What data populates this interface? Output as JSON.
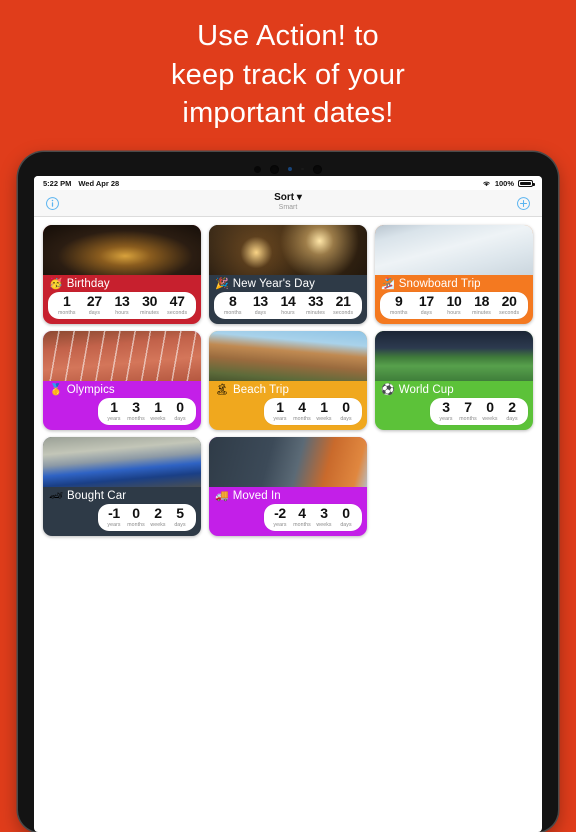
{
  "promo": {
    "lines": [
      "Use Action! to",
      "keep track of your",
      "important dates!"
    ],
    "bg_color": "#E03D1B",
    "text_color": "#FFFFFF"
  },
  "status_bar": {
    "time": "5:22 PM",
    "date": "Wed Apr 28",
    "wifi_icon": "wifi-icon",
    "battery_percent": "100%",
    "battery_icon": "battery-full-icon"
  },
  "navbar": {
    "info_icon": "info-circle-icon",
    "sort_label": "Sort ▾",
    "sort_sublabel": "Smart",
    "add_icon": "plus-circle-icon"
  },
  "cards": [
    {
      "title": "Birthday",
      "emoji": "🥳",
      "icon_name": "party-face-emoji",
      "color": "#C7202E",
      "photo": "birthday-cake-candles-photo",
      "pill_mode": "full",
      "units": [
        {
          "value": "1",
          "label": "months"
        },
        {
          "value": "27",
          "label": "days"
        },
        {
          "value": "13",
          "label": "hours"
        },
        {
          "value": "30",
          "label": "minutes"
        },
        {
          "value": "47",
          "label": "seconds"
        }
      ]
    },
    {
      "title": "New Year's Day",
      "emoji": "🎉",
      "icon_name": "party-popper-emoji",
      "color": "#2E3A47",
      "photo": "sparkler-bokeh-photo",
      "pill_mode": "full",
      "units": [
        {
          "value": "8",
          "label": "months"
        },
        {
          "value": "13",
          "label": "days"
        },
        {
          "value": "14",
          "label": "hours"
        },
        {
          "value": "33",
          "label": "minutes"
        },
        {
          "value": "21",
          "label": "seconds"
        }
      ]
    },
    {
      "title": "Snowboard Trip",
      "emoji": "🏂",
      "icon_name": "snowboarder-emoji",
      "color": "#F47920",
      "photo": "snowy-mountain-slope-photo",
      "pill_mode": "full",
      "units": [
        {
          "value": "9",
          "label": "months"
        },
        {
          "value": "17",
          "label": "days"
        },
        {
          "value": "10",
          "label": "hours"
        },
        {
          "value": "18",
          "label": "minutes"
        },
        {
          "value": "20",
          "label": "seconds"
        }
      ]
    },
    {
      "title": "Olympics",
      "emoji": "🥇",
      "icon_name": "gold-medal-emoji",
      "color": "#C31FE8",
      "photo": "running-track-athletes-photo",
      "pill_mode": "four",
      "units": [
        {
          "value": "1",
          "label": "years"
        },
        {
          "value": "3",
          "label": "months"
        },
        {
          "value": "1",
          "label": "weeks"
        },
        {
          "value": "0",
          "label": "days"
        }
      ]
    },
    {
      "title": "Beach Trip",
      "emoji": "🏝",
      "icon_name": "desert-island-emoji",
      "color": "#F0A81E",
      "photo": "cinque-terre-cliffside-town-photo",
      "pill_mode": "four",
      "units": [
        {
          "value": "1",
          "label": "years"
        },
        {
          "value": "4",
          "label": "months"
        },
        {
          "value": "1",
          "label": "weeks"
        },
        {
          "value": "0",
          "label": "days"
        }
      ]
    },
    {
      "title": "World Cup",
      "emoji": "⚽",
      "icon_name": "soccer-ball-emoji",
      "color": "#5CC239",
      "photo": "soccer-stadium-pitch-photo",
      "pill_mode": "four",
      "units": [
        {
          "value": "3",
          "label": "years"
        },
        {
          "value": "7",
          "label": "months"
        },
        {
          "value": "0",
          "label": "weeks"
        },
        {
          "value": "2",
          "label": "days"
        }
      ]
    },
    {
      "title": "Bought Car",
      "emoji": "🏎",
      "icon_name": "racing-car-emoji",
      "color": "#2E3A47",
      "photo": "blue-sports-car-photo",
      "pill_mode": "four",
      "units": [
        {
          "value": "-1",
          "label": "years"
        },
        {
          "value": "0",
          "label": "months"
        },
        {
          "value": "2",
          "label": "weeks"
        },
        {
          "value": "5",
          "label": "days"
        }
      ]
    },
    {
      "title": "Moved In",
      "emoji": "🚚",
      "icon_name": "delivery-truck-emoji",
      "color": "#C31FE8",
      "photo": "apartment-building-balconies-photo",
      "pill_mode": "four",
      "units": [
        {
          "value": "-2",
          "label": "years"
        },
        {
          "value": "4",
          "label": "months"
        },
        {
          "value": "3",
          "label": "weeks"
        },
        {
          "value": "0",
          "label": "days"
        }
      ]
    }
  ]
}
